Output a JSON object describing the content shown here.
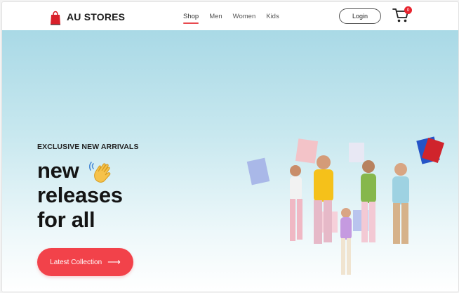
{
  "brand": {
    "name": "AU STORES",
    "accent": "#e84a4f"
  },
  "nav": {
    "items": [
      {
        "label": "Shop",
        "active": true
      },
      {
        "label": "Men",
        "active": false
      },
      {
        "label": "Women",
        "active": false
      },
      {
        "label": "Kids",
        "active": false
      }
    ]
  },
  "header": {
    "login_label": "Login",
    "cart_count": "0",
    "cart_icon": "cart-icon"
  },
  "hero": {
    "eyebrow": "EXCLUSIVE NEW ARRIVALS",
    "headline": [
      "new",
      "releases",
      "for all"
    ],
    "cta_label": "Latest Collection",
    "cta_color": "#f2424a"
  }
}
